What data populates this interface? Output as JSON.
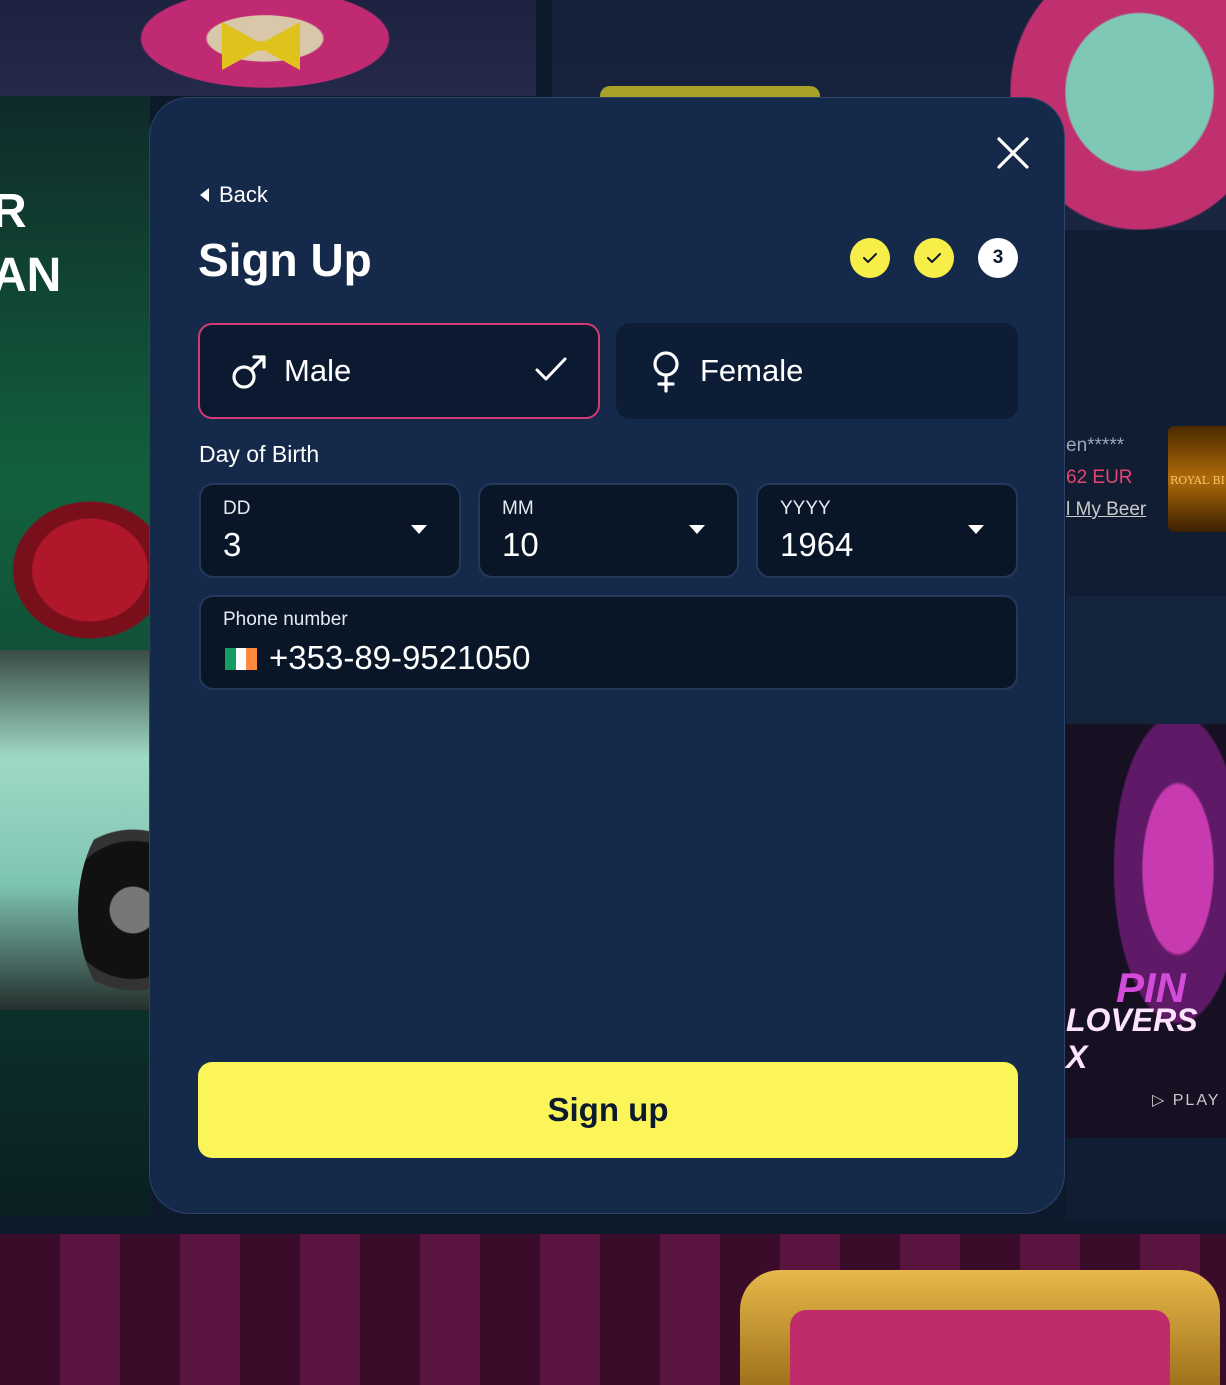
{
  "background": {
    "promo_text_lines": [
      "R",
      "AN"
    ],
    "ticker": {
      "user": "en*****",
      "amount": "62 EUR",
      "game": "l My Beer"
    },
    "thumb_label": "ROYAL BI",
    "game_tile": {
      "line1": "PIN",
      "line2": "LOVERS X",
      "provider": "PLAY"
    }
  },
  "modal": {
    "back_label": "Back",
    "title": "Sign Up",
    "steps": [
      {
        "state": "done"
      },
      {
        "state": "done"
      },
      {
        "state": "current",
        "label": "3"
      }
    ],
    "gender": {
      "male_label": "Male",
      "female_label": "Female",
      "selected": "Male"
    },
    "dob": {
      "label": "Day of Birth",
      "day": {
        "label": "DD",
        "value": "3"
      },
      "month": {
        "label": "MM",
        "value": "10"
      },
      "year": {
        "label": "YYYY",
        "value": "1964"
      }
    },
    "phone": {
      "label": "Phone number",
      "country_flag": "ireland-flag",
      "value": "+353-89-9521050"
    },
    "submit_label": "Sign up"
  },
  "colors": {
    "modal_bg": "#152a4b",
    "accent_yellow": "#fbf55a",
    "selected_border": "#d23a75",
    "field_bg": "#091628"
  }
}
